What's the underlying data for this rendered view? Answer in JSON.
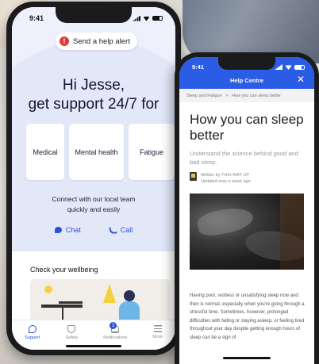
{
  "phone1": {
    "status": {
      "time": "9:41"
    },
    "alert_button": {
      "icon": "!",
      "label": "Send a help alert"
    },
    "greeting": {
      "line1": "Hi Jesse,",
      "line2": "get support 24/7 for"
    },
    "cards": [
      {
        "label": "Medical"
      },
      {
        "label": "Mental health"
      },
      {
        "label": "Fatigue"
      }
    ],
    "connect": {
      "line1": "Connect with our local team",
      "line2": "quickly and easily"
    },
    "actions": {
      "chat": "Chat",
      "call": "Call"
    },
    "wellbeing": {
      "title": "Check your wellbeing"
    },
    "tabs": [
      {
        "label": "Support",
        "icon": "support-icon",
        "active": true
      },
      {
        "label": "Safety",
        "icon": "shield-icon"
      },
      {
        "label": "Notifications",
        "icon": "bell-icon",
        "badge": "2"
      },
      {
        "label": "More",
        "icon": "menu-icon"
      }
    ],
    "accent_color": "#2a52d6"
  },
  "phone2": {
    "status": {
      "time": "9:41"
    },
    "header": {
      "title": "Help Centre",
      "close": "✕"
    },
    "breadcrumb": {
      "item1": "Sleep and Fatigue",
      "separator": ">",
      "item2": "How you can sleep better"
    },
    "article": {
      "title": "How you can sleep better",
      "subtitle": "Understand the science behind good and bad sleep.",
      "author_line": "Written by THIS WAY UP",
      "updated": "Updated over a week ago",
      "body": "Having poor, restless or unsatisfying sleep now and then is normal, especially when you're going through a stressful time. Sometimes, however, prolonged difficulties with falling or staying asleep, or feeling tired throughout your day despite getting enough hours of sleep can be a sign of"
    },
    "header_color": "#2b5ce6"
  }
}
